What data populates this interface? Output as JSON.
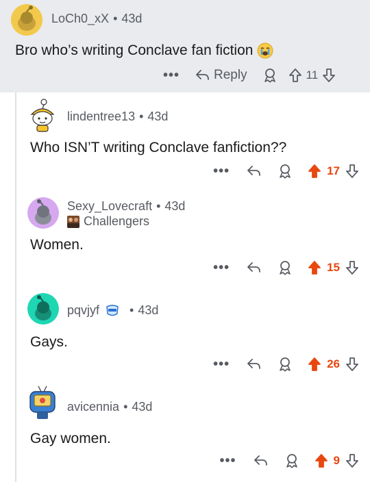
{
  "top_comment": {
    "username": "LoCh0_xX",
    "age": "43d",
    "body": "Bro who’s writing Conclave fan fiction",
    "emoji": "😭",
    "reply_label": "Reply",
    "more_label": "•••",
    "vote_count": "11",
    "upvoted": false
  },
  "replies": [
    {
      "username": "lindentree13",
      "age": "43d",
      "body": "Who ISN’T writing Conclave fanfiction??",
      "more_label": "•••",
      "vote_count": "17",
      "upvoted": true
    },
    {
      "username": "Sexy_Lovecraft",
      "age": "43d",
      "flair": "Challengers",
      "body": "Women.",
      "more_label": "•••",
      "vote_count": "15",
      "upvoted": true
    },
    {
      "username": "pqvjyf",
      "age": "43d",
      "body": "Gays.",
      "more_label": "•••",
      "vote_count": "26",
      "upvoted": true
    },
    {
      "username": "avicennia",
      "age": "43d",
      "body": "Gay women.",
      "more_label": "•••",
      "vote_count": "9",
      "upvoted": true
    }
  ],
  "colors": {
    "upvote": "#e8470f",
    "muted": "#575b61",
    "top_bg": "#e9ebee",
    "thread_line": "#dfe1e4"
  },
  "icons": [
    "snoo-avatar",
    "more-icon",
    "reply-arrow-icon",
    "award-icon",
    "upvote-icon",
    "downvote-icon",
    "flair-icon"
  ]
}
